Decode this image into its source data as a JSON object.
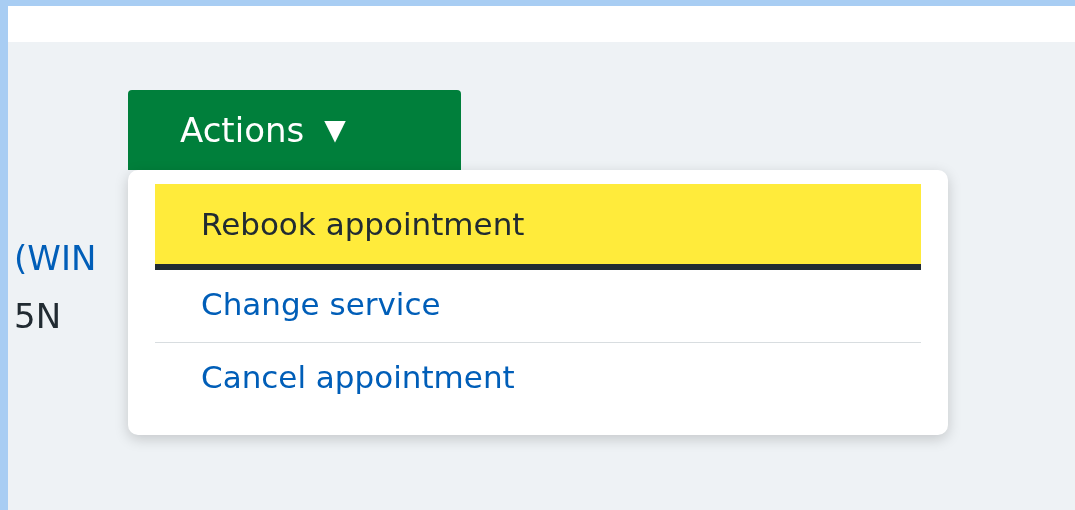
{
  "actions_button": {
    "label": "Actions",
    "caret": "▼",
    "expanded": true
  },
  "background_text": [
    {
      "text": "(WIN",
      "kind": "link"
    },
    {
      "text": "5N",
      "kind": "plain"
    }
  ],
  "menu": {
    "items": [
      {
        "label": "Rebook appointment",
        "selected": true
      },
      {
        "label": "Change service",
        "selected": false
      },
      {
        "label": "Cancel appointment",
        "selected": false
      }
    ]
  }
}
